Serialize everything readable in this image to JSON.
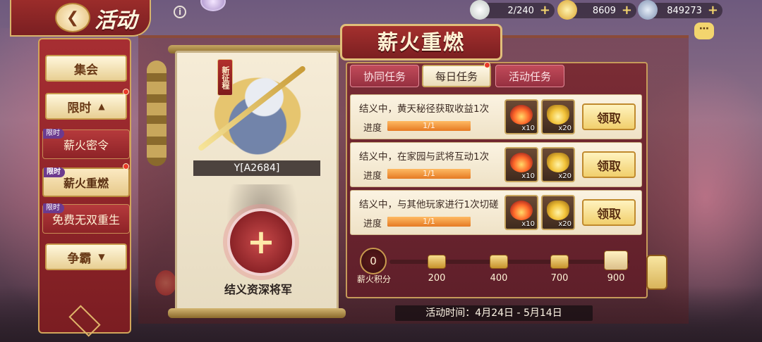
{
  "header": {
    "title": "活动",
    "back_icon": "back-arrow-icon",
    "info_icon": "info-icon"
  },
  "resources": [
    {
      "name": "silver",
      "value": "2/240"
    },
    {
      "name": "gold-ingot",
      "value": "8609"
    },
    {
      "name": "coin",
      "value": "849273"
    }
  ],
  "sidebar": {
    "categories": [
      {
        "label": "集会"
      },
      {
        "label": "限时",
        "expanded": true
      }
    ],
    "items": [
      {
        "tag": "限时",
        "label": "薪火密令",
        "active": false
      },
      {
        "tag": "限时",
        "label": "薪火重燃",
        "active": true
      },
      {
        "tag": "限时",
        "label": "免费无双重生",
        "active": false
      }
    ],
    "bottom_category": {
      "label": "争霸"
    }
  },
  "hero": {
    "badge": "新征程",
    "name": "Y[A2684]",
    "slot_label": "结义资深将军",
    "slot_plus": "+"
  },
  "event": {
    "title": "薪火重燃",
    "tabs": [
      {
        "label": "协同任务",
        "active": false
      },
      {
        "label": "每日任务",
        "active": true,
        "dot": true
      },
      {
        "label": "活动任务",
        "active": false
      }
    ],
    "progress_label": "进度",
    "claim_label": "领取",
    "tasks": [
      {
        "desc": "结义中，黄天秘径获取收益1次",
        "progress": "1/1",
        "progress_fraction": 1.0,
        "rewards": [
          {
            "icon": "fire-icon",
            "qty": "x10"
          },
          {
            "icon": "gold-ingot-icon",
            "qty": "x20"
          }
        ]
      },
      {
        "desc": "结义中，在家园与武将互动1次",
        "progress": "1/1",
        "progress_fraction": 1.0,
        "rewards": [
          {
            "icon": "fire-icon",
            "qty": "x10"
          },
          {
            "icon": "gold-ingot-icon",
            "qty": "x20"
          }
        ]
      },
      {
        "desc": "结义中，与其他玩家进行1次切磋",
        "progress": "1/1",
        "progress_fraction": 1.0,
        "rewards": [
          {
            "icon": "fire-icon",
            "qty": "x10"
          },
          {
            "icon": "gold-ingot-icon",
            "qty": "x20"
          }
        ]
      }
    ],
    "points": {
      "current": "0",
      "label": "薪火积分",
      "milestones": [
        "200",
        "400",
        "700",
        "900"
      ]
    },
    "time": "活动时间：4月24日 - 5月14日"
  }
}
